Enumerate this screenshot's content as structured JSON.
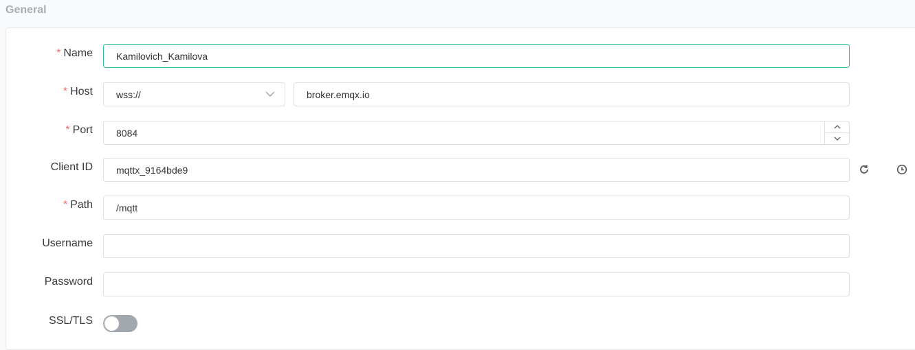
{
  "section": {
    "title": "General"
  },
  "form": {
    "name": {
      "label": "Name",
      "required": "*",
      "value": "Kamilovich_Kamilova"
    },
    "host": {
      "label": "Host",
      "required": "*",
      "protocol": "wss://",
      "value": "broker.emqx.io"
    },
    "port": {
      "label": "Port",
      "required": "*",
      "value": "8084"
    },
    "client_id": {
      "label": "Client ID",
      "value": "mqttx_9164bde9"
    },
    "path": {
      "label": "Path",
      "required": "*",
      "value": "/mqtt"
    },
    "username": {
      "label": "Username",
      "value": ""
    },
    "password": {
      "label": "Password",
      "value": ""
    },
    "ssl": {
      "label": "SSL/TLS",
      "enabled": false
    }
  },
  "icons": {
    "refresh": "refresh-icon",
    "clock": "clock-icon",
    "chevron": "chevron-down-icon"
  },
  "colors": {
    "required": "#f56c6c",
    "focus_border": "#34c388",
    "toggle_off": "#a3a7ae"
  }
}
